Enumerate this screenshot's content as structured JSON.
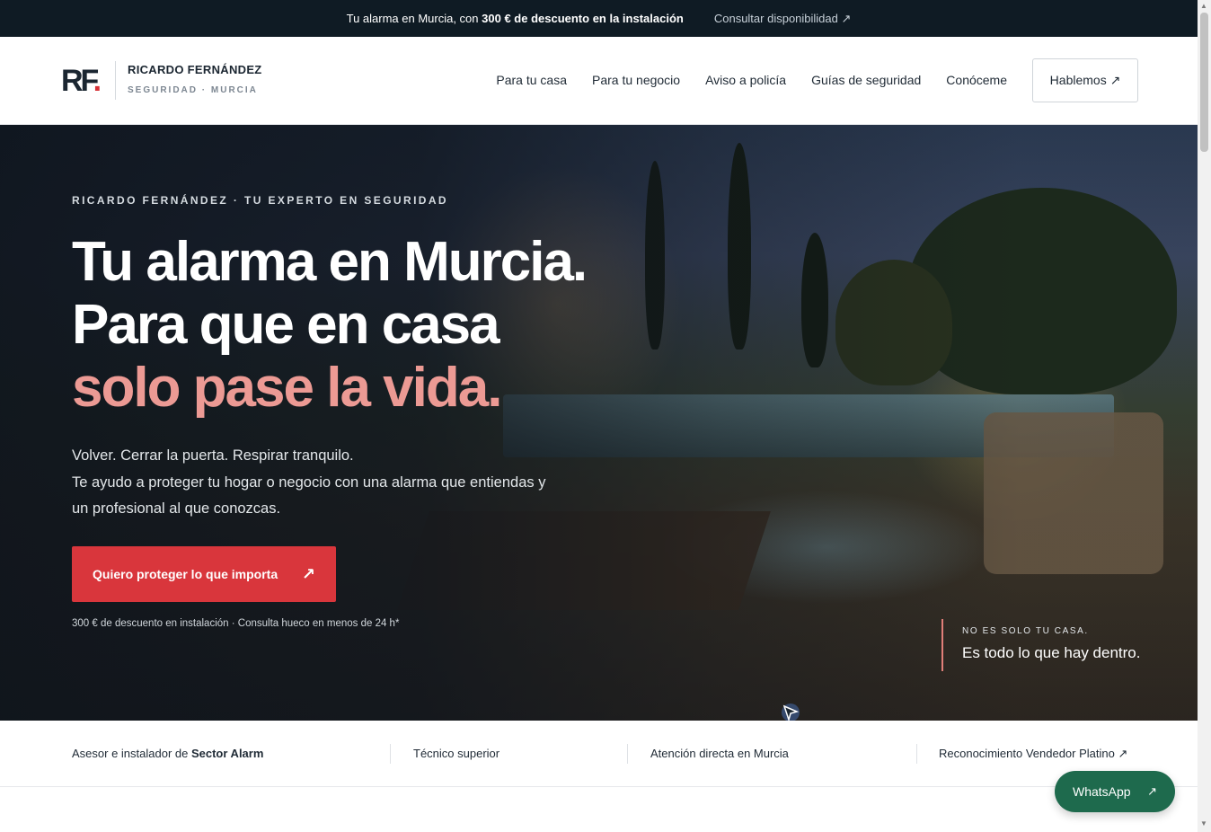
{
  "topbar": {
    "promo_prefix": "Tu alarma en Murcia, con ",
    "promo_bold": "300 € de descuento en la instalación",
    "availability_link": "Consultar disponibilidad ↗"
  },
  "header": {
    "logo_letters": "RF",
    "logo_dot": ".",
    "brand_name": "RICARDO FERNÁNDEZ",
    "brand_sub": "SEGURIDAD · MURCIA",
    "nav": [
      "Para tu casa",
      "Para tu negocio",
      "Aviso a policía",
      "Guías de seguridad",
      "Conóceme"
    ],
    "cta": "Hablemos ↗"
  },
  "hero": {
    "eyebrow": "RICARDO FERNÁNDEZ · TU EXPERTO EN SEGURIDAD",
    "title_line1": "Tu alarma en Murcia.",
    "title_line2": "Para que en casa",
    "title_line3_accent": "solo pase la vida.",
    "subtitle_line1": "Volver. Cerrar la puerta. Respirar tranquilo.",
    "subtitle_line2": "Te ayudo a proteger tu hogar o negocio con una alarma que entiendas y",
    "subtitle_line3": "un profesional al que conozcas.",
    "cta_label": "Quiero proteger lo que importa",
    "cta_arrow": "↗",
    "note": "300 € de descuento en instalación · Consulta hueco en menos de 24 h*",
    "quote_eyebrow": "NO ES SOLO TU CASA.",
    "quote_text": "Es todo lo que hay dentro."
  },
  "trust": {
    "item1_prefix": "Asesor e instalador de ",
    "item1_bold": "Sector Alarm",
    "item2": "Técnico superior",
    "item3": "Atención directa en Murcia",
    "item4": "Reconocimiento Vendedor Platino ↗"
  },
  "whatsapp": {
    "label": "WhatsApp",
    "arrow": "↗"
  },
  "colors": {
    "accent_red": "#d9363c",
    "accent_salmon": "#ec9a94",
    "topbar_bg": "#0f1b24",
    "whatsapp_green": "#1e6a4d"
  },
  "icons": [
    "external-arrow-icon",
    "cursor-icon"
  ]
}
